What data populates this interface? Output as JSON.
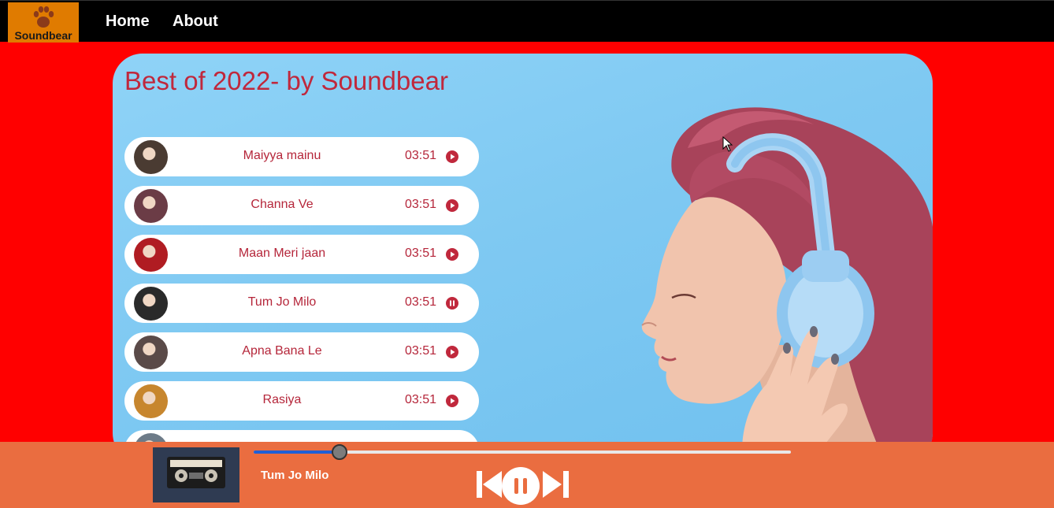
{
  "nav": {
    "logo_text": "Soundbear",
    "links": [
      "Home",
      "About"
    ]
  },
  "card": {
    "title": "Best of 2022- by Soundbear"
  },
  "songs": [
    {
      "name": "Maiyya mainu",
      "time": "03:51",
      "state": "play",
      "thumb_color": "#4a3b32"
    },
    {
      "name": "Channa Ve",
      "time": "03:51",
      "state": "play",
      "thumb_color": "#6b3c46"
    },
    {
      "name": "Maan Meri jaan",
      "time": "03:51",
      "state": "play",
      "thumb_color": "#b01c22"
    },
    {
      "name": "Tum Jo Milo",
      "time": "03:51",
      "state": "pause",
      "thumb_color": "#2a2a2a"
    },
    {
      "name": "Apna Bana Le",
      "time": "03:51",
      "state": "play",
      "thumb_color": "#5a4a48"
    },
    {
      "name": "Rasiya",
      "time": "03:51",
      "state": "play",
      "thumb_color": "#c7862e"
    },
    {
      "name": "",
      "time": "",
      "state": "",
      "thumb_color": "#6d7b88"
    }
  ],
  "player": {
    "now_playing": "Tum Jo Milo",
    "progress": 0.16,
    "is_playing": true
  },
  "colors": {
    "background": "#ff0000",
    "nav": "#000000",
    "logo_bg": "#e07b00",
    "card": "#8fd3f7",
    "accent": "#c0283c",
    "player_bar": "#ea6d40",
    "progress": "#1f5fd6"
  },
  "icons": {
    "logo": "paw-icon",
    "song_play": "play-circle-icon",
    "song_pause": "pause-circle-icon",
    "prev": "skip-previous-icon",
    "main": "pause-icon",
    "next": "skip-next-icon"
  }
}
